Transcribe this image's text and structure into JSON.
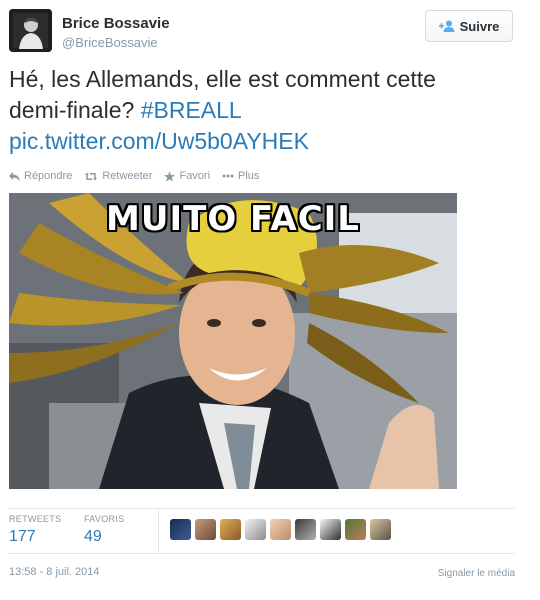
{
  "tweet": {
    "author_name": "Brice Bossavie",
    "author_handle": "@BriceBossavie",
    "follow_label": "Suivre",
    "text_line1": "Hé, les Allemands, elle est comment cette",
    "text_line2_prefix": "demi-finale? ",
    "hashtag": "#BREALL",
    "pic_link": "pic.twitter.com/Uw5b0AYHEK",
    "timestamp": "13:58 - 8 juil. 2014",
    "report_media": "Signaler le média"
  },
  "actions": [
    {
      "label": "Répondre",
      "icon": "reply-icon"
    },
    {
      "label": "Retweeter",
      "icon": "retweet-icon"
    },
    {
      "label": "Favori",
      "icon": "star-icon"
    },
    {
      "label": "Plus",
      "icon": "more-icon"
    }
  ],
  "media": {
    "caption": "MUITO FACIL"
  },
  "stats": {
    "retweets_label": "RETWEETS",
    "retweets_count": "177",
    "favorites_label": "FAVORIS",
    "favorites_count": "49"
  },
  "colors": {
    "link": "#2b7bb9",
    "muted": "#8899a6",
    "text": "#292f33"
  }
}
